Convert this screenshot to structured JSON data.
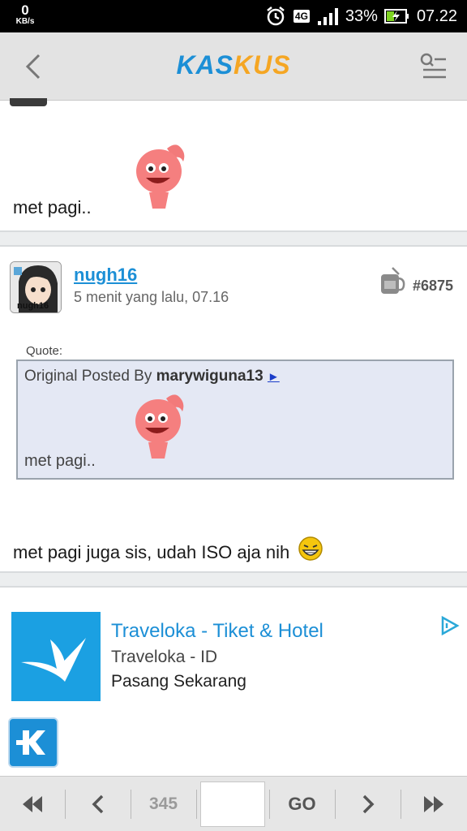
{
  "status_bar": {
    "speed_value": "0",
    "speed_unit": "KB/s",
    "network": "4G",
    "battery": "33%",
    "time": "07.22",
    "icons": [
      "alarm-icon",
      "signal-icon",
      "battery-charging-icon"
    ]
  },
  "header": {
    "logo_part1": "KAS",
    "logo_part2": "KUS",
    "icons": [
      "back-icon",
      "search-menu-icon"
    ]
  },
  "post_prev": {
    "text": "met pagi.."
  },
  "post": {
    "avatar_caption": "nugh16",
    "username": "nugh16",
    "time": "5 menit yang lalu, 07.16",
    "number": "#6875",
    "quote": {
      "label": "Quote:",
      "prefix": "Original Posted By",
      "author": "marywiguna13",
      "arrow": "►",
      "text": "met pagi.."
    },
    "body": "met pagi juga sis, udah ISO aja nih"
  },
  "ad": {
    "title": "Traveloka - Tiket & Hotel",
    "subtitle": "Traveloka - ID",
    "cta": "Pasang Sekarang",
    "icons": [
      "traveloka-bird-icon",
      "adchoices-icon",
      "kaskus-k-icon"
    ]
  },
  "pager": {
    "current_page": "345",
    "page_input_value": "",
    "go_label": "GO",
    "icons": [
      "first-page-icon",
      "prev-page-icon",
      "next-page-icon",
      "last-page-icon"
    ]
  },
  "colors": {
    "accent": "#1c8fd6",
    "logo_orange": "#f5a623",
    "quote_bg": "#e4e8f4",
    "ad_logo_bg": "#1ba0e2"
  }
}
